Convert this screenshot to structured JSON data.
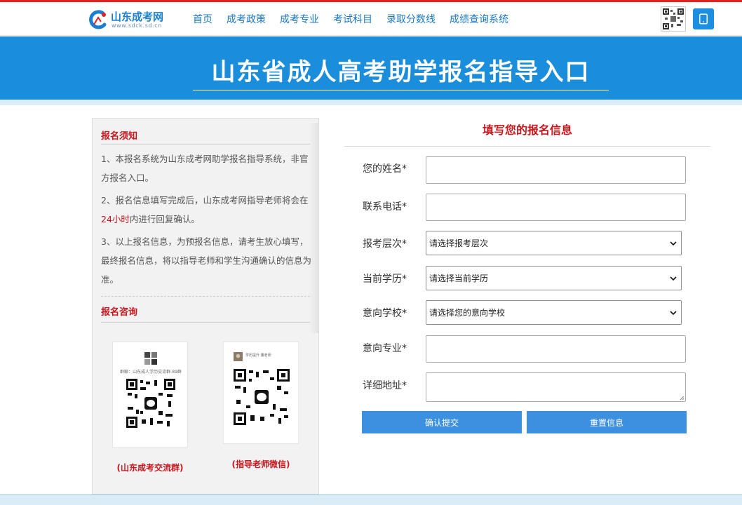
{
  "header": {
    "logo_title": "山东成考网",
    "logo_url": "www.sdck.sd.cn",
    "nav": [
      "首页",
      "成考政策",
      "成考专业",
      "考试科目",
      "录取分数线",
      "成绩查询系统"
    ],
    "icons": [
      "qr-code-icon",
      "phone-icon"
    ]
  },
  "banner": {
    "title": "山东省成人高考助学报名指导入口"
  },
  "notice": {
    "title": "报名须知",
    "items": [
      "1、本报名系统为山东成考网助学报名指导系统，非官方报名入口。",
      "2、报名信息填写完成后，山东成考网指导老师将会在",
      "24小时",
      "内进行回复确认。",
      "3、以上报名信息，为预报名信息，请考生放心填写，最终报名信息，将以指导老师和学生沟通确认的信息为准。"
    ]
  },
  "consult": {
    "title": "报名咨询",
    "group_card_text": "群聊：山东成人学历交流群-89群",
    "group_caption": "(山东成考交流群)",
    "teacher_card_name": "学历提升  董老师",
    "teacher_caption": "(指导老师微信)"
  },
  "form": {
    "title": "填写您的报名信息",
    "labels": {
      "name": "您的姓名*",
      "phone": "联系电话*",
      "level": "报考层次*",
      "education": "当前学历*",
      "school": "意向学校*",
      "major": "意向专业*",
      "address": "详细地址*"
    },
    "selects": {
      "level": "请选择报考层次",
      "education": "请选择当前学历",
      "school": "请选择您的意向学校"
    },
    "submit": "确认提交",
    "reset": "重置信息"
  },
  "colors": {
    "brand_blue": "#1b8edb",
    "accent_red": "#c8161d",
    "button_blue": "#3d8fdf"
  }
}
